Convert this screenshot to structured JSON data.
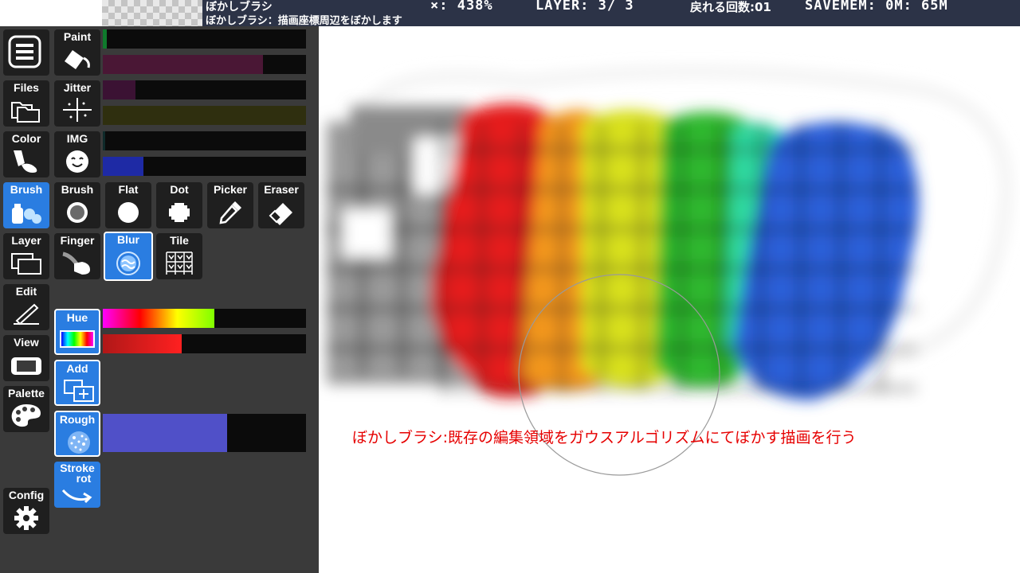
{
  "status": {
    "brush_name": "ぼかしブラシ",
    "brush_desc": "ぼかしブラシ：描画座標周辺をぼかします",
    "zoom": "×:  438%",
    "layer": "LAYER:  3/ 3",
    "undo": "戻れる回数:01",
    "savemem": "SAVEMEM:   0M: 65M"
  },
  "sidebar": {
    "menu": "menu-icon",
    "files": "Files",
    "color": "Color",
    "brush": "Brush",
    "layer": "Layer",
    "edit": "Edit",
    "view": "View",
    "palette": "Palette",
    "config": "Config"
  },
  "tools": {
    "paint": "Paint",
    "jitter": "Jitter",
    "img": "IMG",
    "brush": "Brush",
    "flat": "Flat",
    "dot": "Dot",
    "picker": "Picker",
    "eraser": "Eraser",
    "finger": "Finger",
    "blur": "Blur",
    "tile": "Tile",
    "hue": "Hue",
    "add": "Add",
    "rough": "Rough",
    "stroke_rot_1": "Stroke",
    "stroke_rot_2": "rot"
  },
  "sliders": {
    "paint_1": 0.02,
    "paint_2": 0.79,
    "jitter_1": 0.16,
    "jitter_2": 1.0,
    "img_1": 0.01,
    "img_2": 0.2,
    "hue_1": 0.55,
    "hue_2": 0.39,
    "rough": 0.61
  },
  "colors": {
    "accent": "#2a7de1",
    "statusbar": "#2c3347",
    "caption": "#e60000"
  },
  "caption": "ぼかしブラシ:既存の編集領域をガウスアルゴリズムにてぼかす描画を行う"
}
